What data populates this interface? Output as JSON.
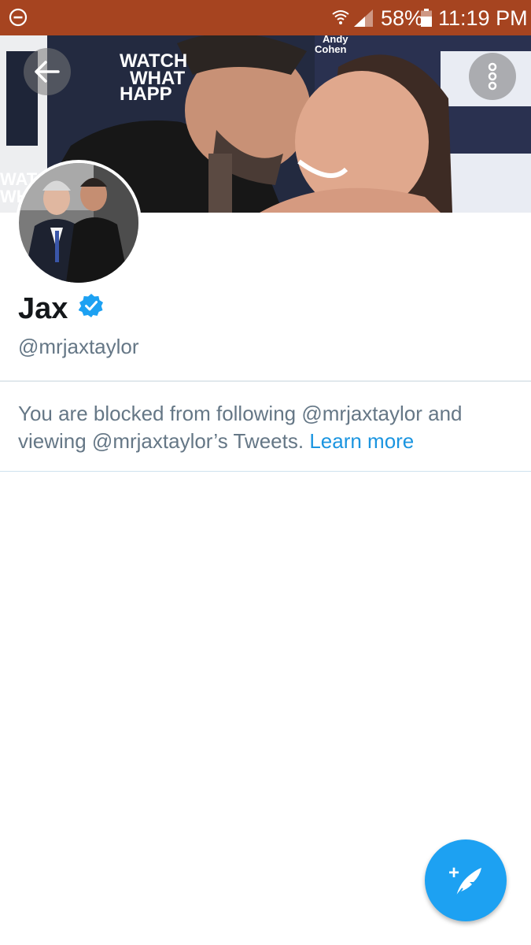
{
  "status_bar": {
    "battery_percent": "58%",
    "time": "11:19 PM",
    "icons": [
      "do-not-disturb-icon",
      "wifi-icon",
      "signal-icon",
      "battery-icon"
    ]
  },
  "header": {
    "back_icon": "arrow-left-icon",
    "more_icon": "more-vertical-icon",
    "banner_text": [
      "WATCH",
      "WHAT",
      "HAPP",
      "Andy",
      "Cohen",
      "WATCH",
      "WHA"
    ]
  },
  "profile": {
    "display_name": "Jax",
    "verified_icon": "verified-badge-icon",
    "handle": "@mrjaxtaylor",
    "blocked_message": "You are blocked from following @mrjaxtaylor and viewing @mrjaxtaylor’s Tweets.",
    "learn_more": "Learn more"
  },
  "fab": {
    "icon": "compose-tweet-icon",
    "plus": "+"
  },
  "colors": {
    "status_bar": "#a64420",
    "accent": "#1da1f2",
    "link": "#1b95e0",
    "secondary_text": "#657786",
    "primary_text": "#14171a"
  }
}
